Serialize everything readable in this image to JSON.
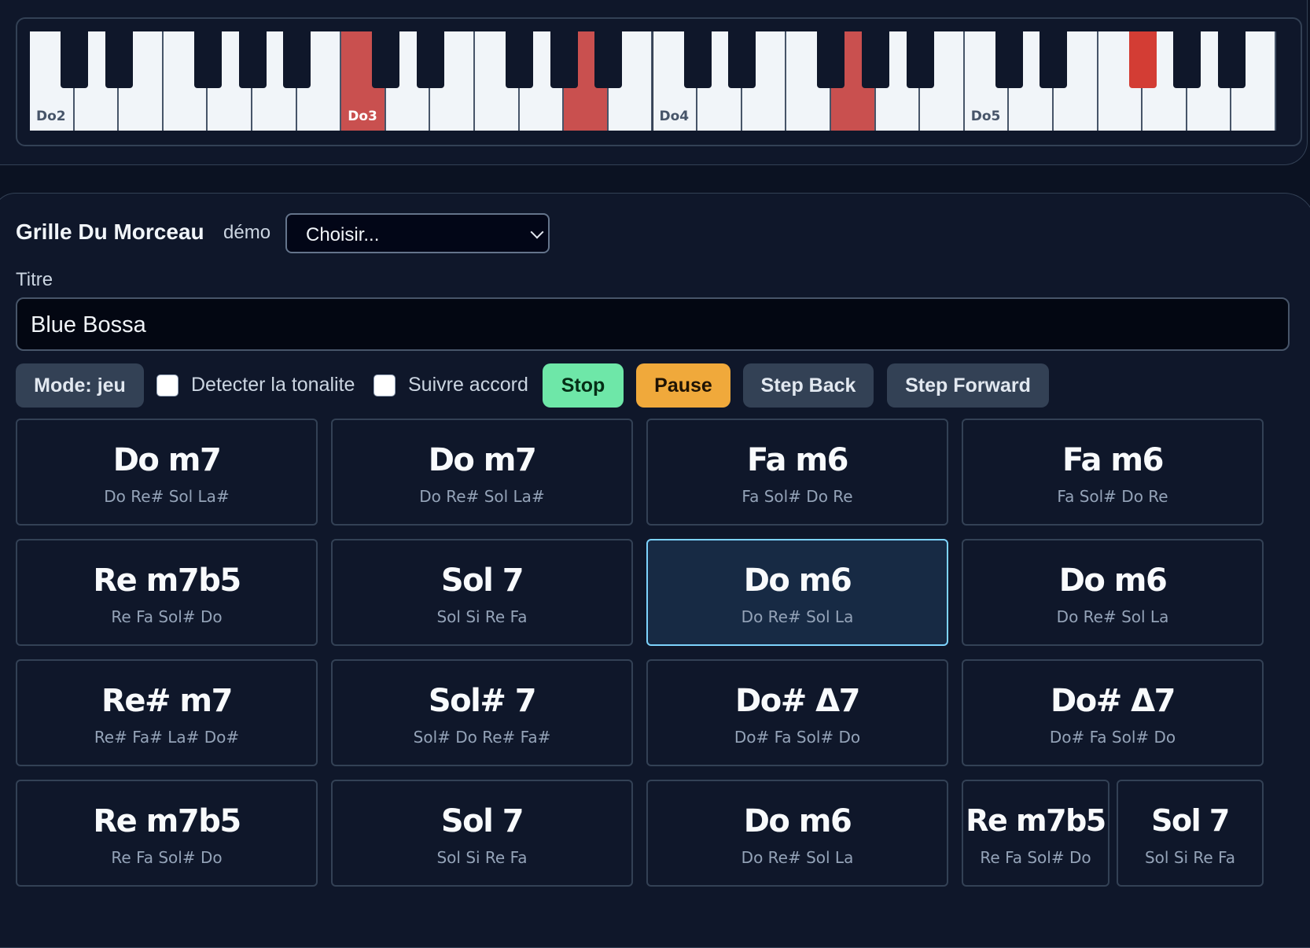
{
  "piano": {
    "octave_labels": [
      "Do2",
      "Do3",
      "Do4",
      "Do5"
    ]
  },
  "grid": {
    "title": "Grille Du Morceau",
    "demo_label": "démo",
    "demo_select_value": "Choisir...",
    "titre_label": "Titre",
    "titre_value": "Blue Bossa"
  },
  "controls": {
    "mode_button": "Mode: jeu",
    "detect_key_label": "Detecter la tonalite",
    "follow_chord_label": "Suivre accord",
    "stop": "Stop",
    "pause": "Pause",
    "step_back": "Step Back",
    "step_forward": "Step Forward"
  },
  "chords": [
    {
      "name": "Do m7",
      "notes": "Do Re# Sol La#"
    },
    {
      "name": "Do m7",
      "notes": "Do Re# Sol La#"
    },
    {
      "name": "Fa m6",
      "notes": "Fa Sol# Do Re"
    },
    {
      "name": "Fa m6",
      "notes": "Fa Sol# Do Re"
    },
    {
      "name": "Re m7b5",
      "notes": "Re Fa Sol# Do"
    },
    {
      "name": "Sol 7",
      "notes": "Sol Si Re Fa"
    },
    {
      "name": "Do m6",
      "notes": "Do Re# Sol La",
      "current": true
    },
    {
      "name": "Do m6",
      "notes": "Do Re# Sol La"
    },
    {
      "name": "Re# m7",
      "notes": "Re# Fa# La# Do#"
    },
    {
      "name": "Sol# 7",
      "notes": "Sol# Do Re# Fa#"
    },
    {
      "name": "Do# Δ7",
      "notes": "Do# Fa Sol# Do"
    },
    {
      "name": "Do# Δ7",
      "notes": "Do# Fa Sol# Do"
    },
    {
      "name": "Re m7b5",
      "notes": "Re Fa Sol# Do"
    },
    {
      "name": "Sol 7",
      "notes": "Sol Si Re Fa"
    },
    {
      "name": "Do m6",
      "notes": "Do Re# Sol La"
    },
    {
      "name": "Re m7b5",
      "notes": "Re Fa Sol# Do"
    },
    {
      "name": "Sol 7",
      "notes": "Sol Si Re Fa"
    }
  ],
  "colors": {
    "active_white_key": "#c9504f",
    "active_black_key": "#d33d34",
    "stop_button": "#6ee7a8",
    "pause_button": "#f0a93b",
    "current_chord_border": "#7dd3fc"
  }
}
